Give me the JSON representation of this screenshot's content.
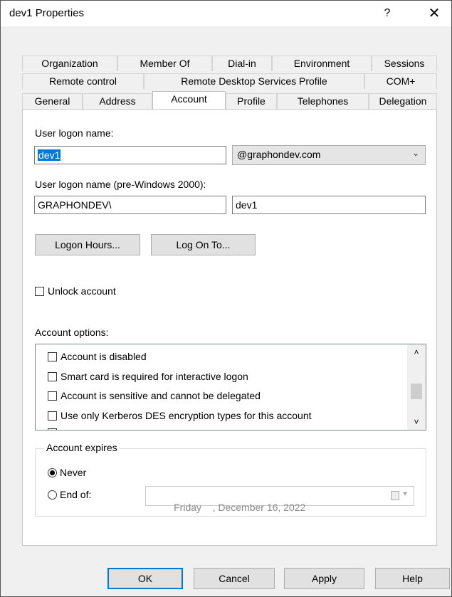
{
  "window": {
    "title": "dev1 Properties",
    "help_glyph": "?",
    "close_glyph": "✕"
  },
  "tabs": {
    "row1": [
      "Organization",
      "Member Of",
      "Dial-in",
      "Environment",
      "Sessions"
    ],
    "row2": [
      "Remote control",
      "Remote Desktop Services Profile",
      "COM+"
    ],
    "row3": [
      "General",
      "Address",
      "Account",
      "Profile",
      "Telephones",
      "Delegation"
    ],
    "active": "Account"
  },
  "account": {
    "logon_name_label": "User logon name:",
    "logon_name_value": "dev1",
    "domain_value": "@graphondev.com",
    "pre2000_label": "User logon name (pre-Windows 2000):",
    "pre2000_domain": "GRAPHONDEV\\",
    "pre2000_user": "dev1",
    "logon_hours_button": "Logon Hours...",
    "log_on_to_button": "Log On To...",
    "unlock_label": "Unlock account",
    "options_label": "Account options:",
    "options": [
      "Account is disabled",
      "Smart card is required for interactive logon",
      "Account is sensitive and cannot be delegated",
      "Use only Kerberos DES encryption types for this account"
    ],
    "expires_title": "Account expires",
    "never_label": "Never",
    "end_of_label": "End of:",
    "end_of_date": "Friday    , December 16, 2022",
    "expires_selected": "Never"
  },
  "buttons": {
    "ok": "OK",
    "cancel": "Cancel",
    "apply": "Apply",
    "help": "Help"
  },
  "colors": {
    "accent": "#0078d7",
    "dialog_bg": "#f0f0f0"
  }
}
